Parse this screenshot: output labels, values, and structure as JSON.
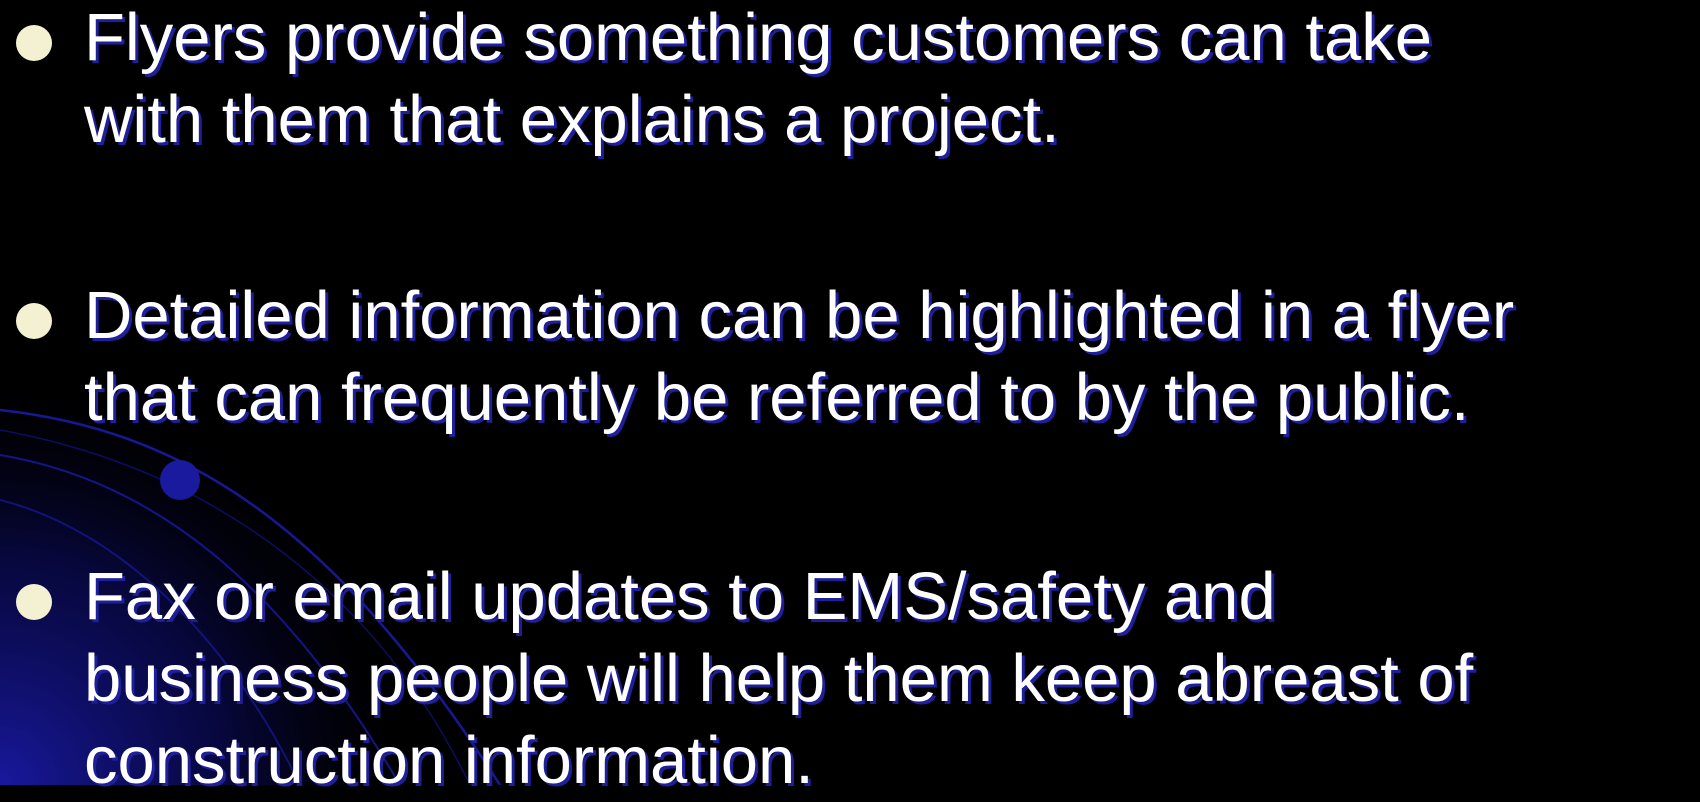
{
  "slide": {
    "bullets": [
      {
        "text": "Flyers provide something customers can take\nwith them that explains a project."
      },
      {
        "text": "Detailed information can be highlighted in a flyer\nthat can frequently be referred to by the public."
      },
      {
        "text": "Fax or email updates to EMS/safety and\nbusiness people will help them keep abreast of\nconstruction information."
      }
    ]
  },
  "colors": {
    "background": "#000000",
    "text": "#ffffff",
    "text_shadow": "#1f1f9a",
    "bullet": "#f4f1d2",
    "accent_blue": "#1a1aa6"
  }
}
